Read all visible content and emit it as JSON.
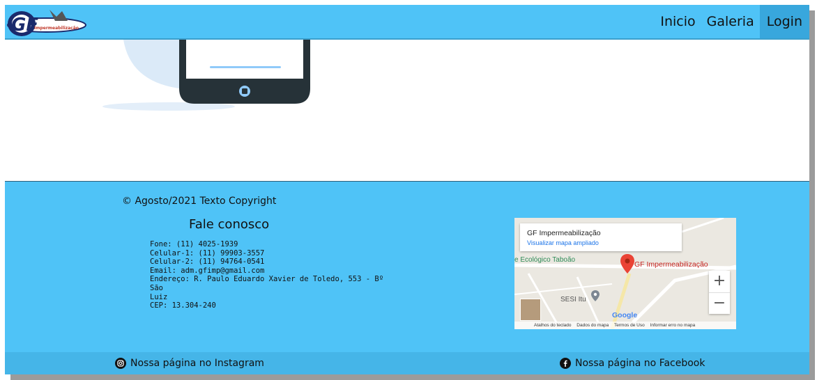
{
  "navbar": {
    "logo_text": "GF",
    "logo_subtext": "Impermeabilização",
    "links": [
      {
        "label": "Inicio"
      },
      {
        "label": "Galeria"
      },
      {
        "label": "Login"
      }
    ]
  },
  "footer": {
    "copyright": "© Agosto/2021 Texto Copyright",
    "contact_title": "Fale conosco",
    "contact_lines": [
      "Fone: (11) 4025-1939",
      "Celular-1: (11) 99903-3557",
      "Celular-2: (11) 94764-0541",
      "Email: adm.gfimp@gmail.com",
      "Endereço: R. Paulo Eduardo Xavier de Toledo, 553 - Bº São",
      "Luiz",
      "CEP: 13.304-240"
    ],
    "map": {
      "card_title": "GF Impermeabilização",
      "card_link": "Visualizar mapa ampliado",
      "place_label": "e Ecológico Taboão",
      "marker_label": "GF Impermeabilização",
      "sesi_label": "SESI Itu",
      "google_label": "Google",
      "zoom_in": "+",
      "zoom_out": "−",
      "footer_items": [
        "Atalhos do teclado",
        "Dados do mapa",
        "Termos de Uso",
        "Informar erro no mapa"
      ]
    }
  },
  "social": {
    "instagram": "Nossa página no Instagram",
    "facebook": "Nossa página no Facebook"
  },
  "colors": {
    "accent": "#4fc3f7",
    "active_nav": "#38a7dd",
    "social_bar": "#45b5e8"
  }
}
